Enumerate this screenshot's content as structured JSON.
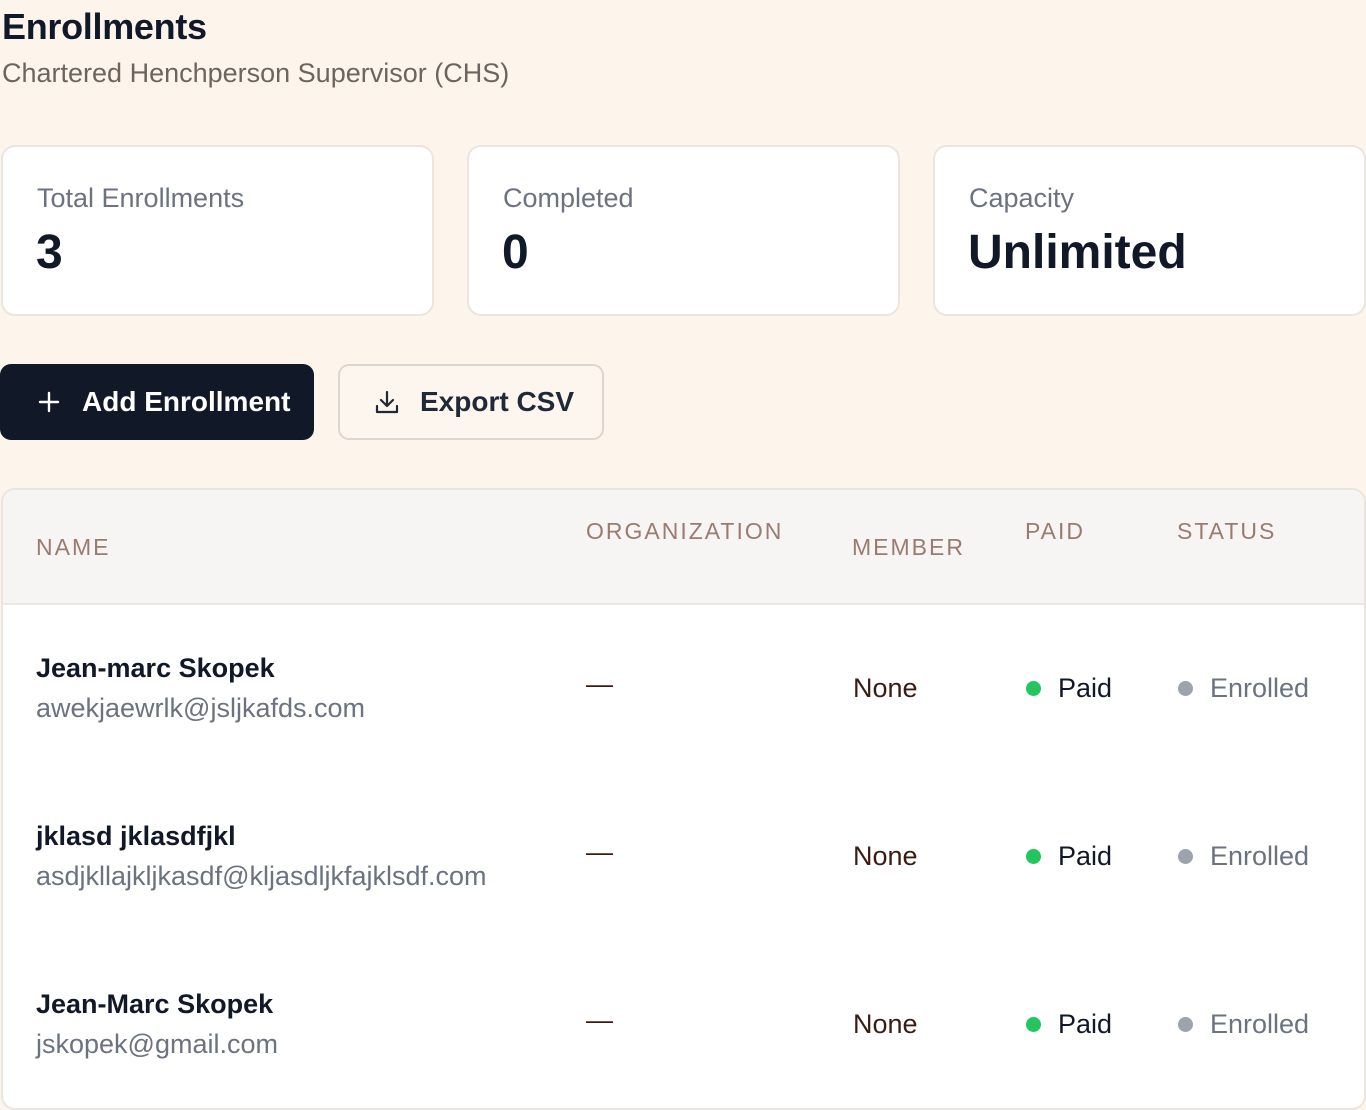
{
  "header": {
    "title": "Enrollments",
    "subtitle": "Chartered Henchperson Supervisor (CHS)"
  },
  "stats": {
    "total": {
      "label": "Total Enrollments",
      "value": "3"
    },
    "completed": {
      "label": "Completed",
      "value": "0"
    },
    "capacity": {
      "label": "Capacity",
      "value": "Unlimited"
    }
  },
  "actions": {
    "add_label": "Add Enrollment",
    "add_icon": "plus-icon",
    "export_label": "Export CSV",
    "export_icon": "download-icon"
  },
  "table": {
    "columns": {
      "name": "NAME",
      "organization": "ORGANIZATION",
      "member": "MEMBER",
      "paid": "PAID",
      "status": "STATUS"
    },
    "rows": [
      {
        "name": "Jean-marc Skopek",
        "email": "awekjaewrlk@jsljkafds.com",
        "organization": "—",
        "member": "None",
        "paid": "Paid",
        "status": "Enrolled"
      },
      {
        "name": "jklasd jklasdfjkl",
        "email": "asdjkllajkljkasdf@kljasdljkfajklsdf.com",
        "organization": "—",
        "member": "None",
        "paid": "Paid",
        "status": "Enrolled"
      },
      {
        "name": "Jean-Marc Skopek",
        "email": "jskopek@gmail.com",
        "organization": "—",
        "member": "None",
        "paid": "Paid",
        "status": "Enrolled"
      }
    ]
  },
  "colors": {
    "background": "#fdf4ec",
    "primary_button": "#111827",
    "paid_dot": "#22c55e",
    "status_dot": "#9ca3af",
    "header_text": "#9a7b6f"
  }
}
